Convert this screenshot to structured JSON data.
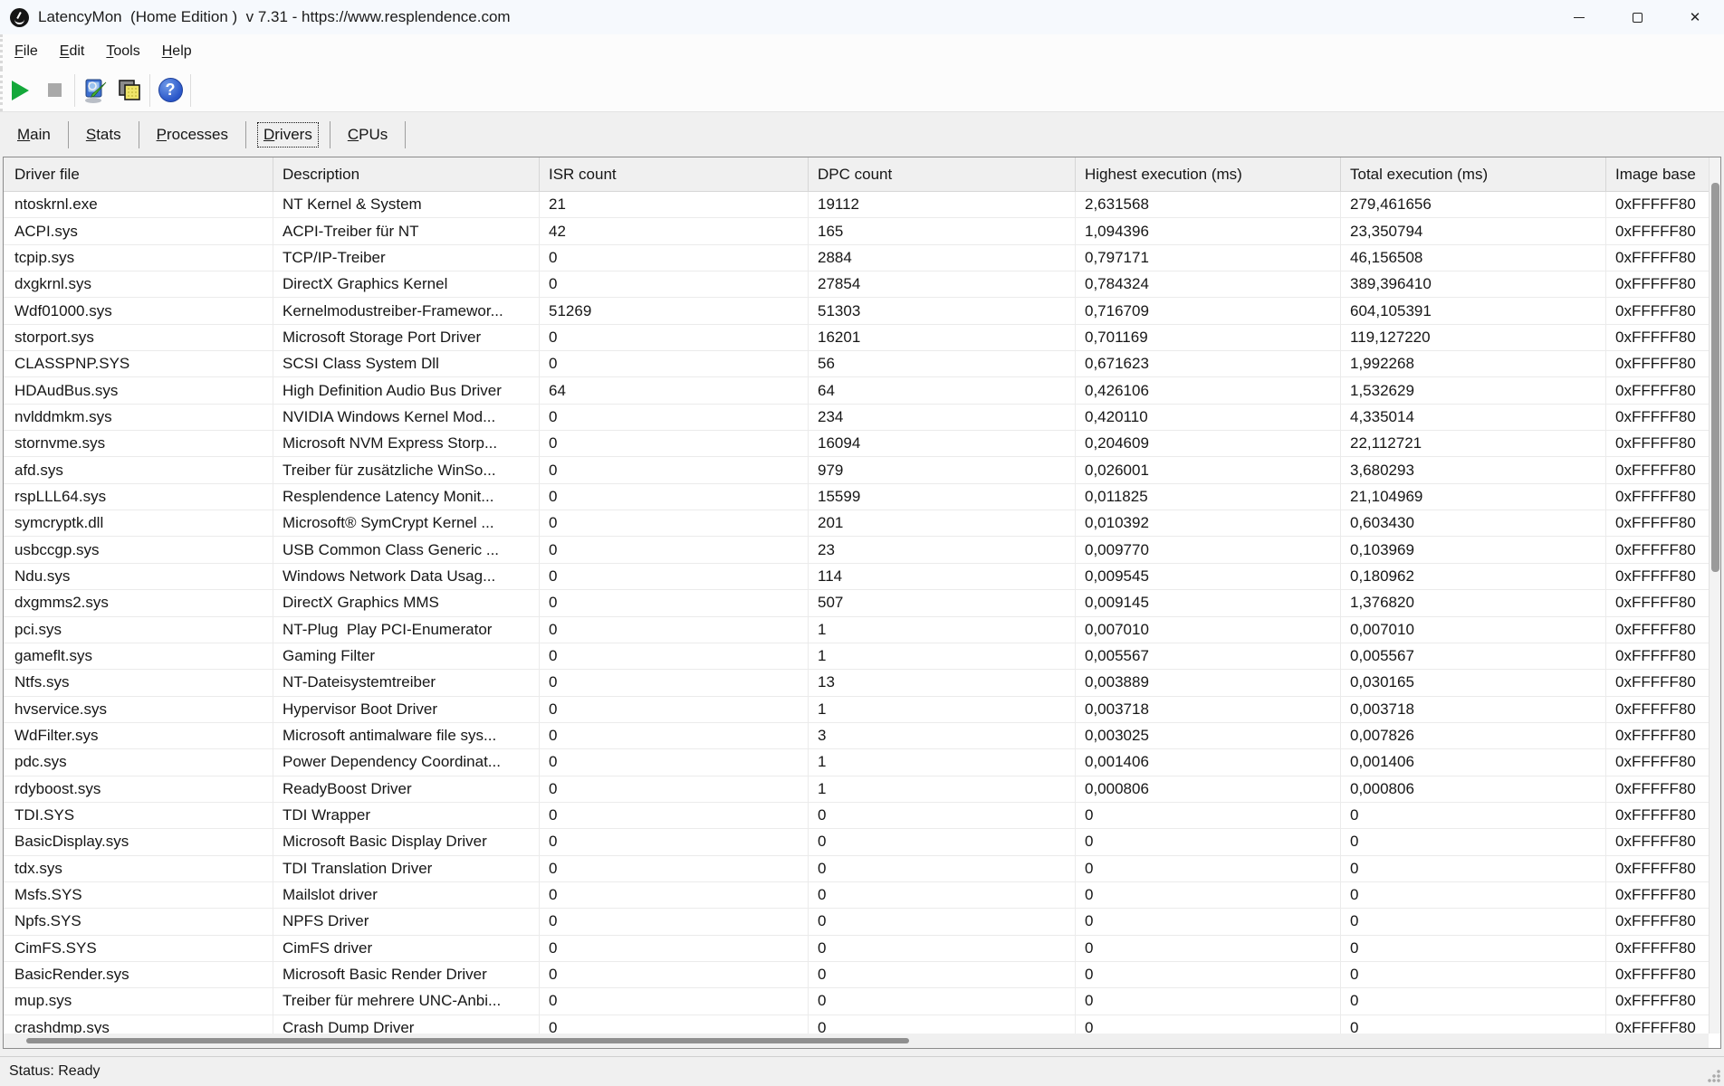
{
  "window": {
    "title": "LatencyMon  (Home Edition )  v 7.31 - https://www.resplendence.com",
    "app_icon": "latencymon-gauge-icon",
    "controls": {
      "minimize": "minimize",
      "maximize": "maximize",
      "close": "close"
    }
  },
  "menu": {
    "items": [
      "File",
      "Edit",
      "Tools",
      "Help"
    ]
  },
  "toolbar": {
    "icons": [
      "start-monitor-icon",
      "stop-monitor-icon",
      "analyze-icon",
      "report-icon",
      "help-icon"
    ]
  },
  "tabs": [
    {
      "label": "Main",
      "active": false
    },
    {
      "label": "Stats",
      "active": false
    },
    {
      "label": "Processes",
      "active": false
    },
    {
      "label": "Drivers",
      "active": true
    },
    {
      "label": "CPUs",
      "active": false
    }
  ],
  "table": {
    "columns": [
      "Driver file",
      "Description",
      "ISR count",
      "DPC count",
      "Highest execution (ms)",
      "Total execution (ms)",
      "Image base"
    ],
    "rows": [
      [
        "ntoskrnl.exe",
        "NT Kernel & System",
        "21",
        "19112",
        "2,631568",
        "279,461656",
        "0xFFFFF80"
      ],
      [
        "ACPI.sys",
        "ACPI-Treiber für NT",
        "42",
        "165",
        "1,094396",
        "23,350794",
        "0xFFFFF80"
      ],
      [
        "tcpip.sys",
        "TCP/IP-Treiber",
        "0",
        "2884",
        "0,797171",
        "46,156508",
        "0xFFFFF80"
      ],
      [
        "dxgkrnl.sys",
        "DirectX Graphics Kernel",
        "0",
        "27854",
        "0,784324",
        "389,396410",
        "0xFFFFF80"
      ],
      [
        "Wdf01000.sys",
        "Kernelmodustreiber-Framewor...",
        "51269",
        "51303",
        "0,716709",
        "604,105391",
        "0xFFFFF80"
      ],
      [
        "storport.sys",
        "Microsoft Storage Port Driver",
        "0",
        "16201",
        "0,701169",
        "119,127220",
        "0xFFFFF80"
      ],
      [
        "CLASSPNP.SYS",
        "SCSI Class System Dll",
        "0",
        "56",
        "0,671623",
        "1,992268",
        "0xFFFFF80"
      ],
      [
        "HDAudBus.sys",
        "High Definition Audio Bus Driver",
        "64",
        "64",
        "0,426106",
        "1,532629",
        "0xFFFFF80"
      ],
      [
        "nvlddmkm.sys",
        "NVIDIA Windows Kernel Mod...",
        "0",
        "234",
        "0,420110",
        "4,335014",
        "0xFFFFF80"
      ],
      [
        "stornvme.sys",
        "Microsoft NVM Express Storp...",
        "0",
        "16094",
        "0,204609",
        "22,112721",
        "0xFFFFF80"
      ],
      [
        "afd.sys",
        "Treiber für zusätzliche WinSo...",
        "0",
        "979",
        "0,026001",
        "3,680293",
        "0xFFFFF80"
      ],
      [
        "rspLLL64.sys",
        "Resplendence Latency Monit...",
        "0",
        "15599",
        "0,011825",
        "21,104969",
        "0xFFFFF80"
      ],
      [
        "symcryptk.dll",
        "Microsoft® SymCrypt Kernel ...",
        "0",
        "201",
        "0,010392",
        "0,603430",
        "0xFFFFF80"
      ],
      [
        "usbccgp.sys",
        "USB Common Class Generic ...",
        "0",
        "23",
        "0,009770",
        "0,103969",
        "0xFFFFF80"
      ],
      [
        "Ndu.sys",
        "Windows Network Data Usag...",
        "0",
        "114",
        "0,009545",
        "0,180962",
        "0xFFFFF80"
      ],
      [
        "dxgmms2.sys",
        "DirectX Graphics MMS",
        "0",
        "507",
        "0,009145",
        "1,376820",
        "0xFFFFF80"
      ],
      [
        "pci.sys",
        "NT-Plug  Play PCI-Enumerator",
        "0",
        "1",
        "0,007010",
        "0,007010",
        "0xFFFFF80"
      ],
      [
        "gameflt.sys",
        "Gaming Filter",
        "0",
        "1",
        "0,005567",
        "0,005567",
        "0xFFFFF80"
      ],
      [
        "Ntfs.sys",
        "NT-Dateisystemtreiber",
        "0",
        "13",
        "0,003889",
        "0,030165",
        "0xFFFFF80"
      ],
      [
        "hvservice.sys",
        "Hypervisor Boot Driver",
        "0",
        "1",
        "0,003718",
        "0,003718",
        "0xFFFFF80"
      ],
      [
        "WdFilter.sys",
        "Microsoft antimalware file sys...",
        "0",
        "3",
        "0,003025",
        "0,007826",
        "0xFFFFF80"
      ],
      [
        "pdc.sys",
        "Power Dependency Coordinat...",
        "0",
        "1",
        "0,001406",
        "0,001406",
        "0xFFFFF80"
      ],
      [
        "rdyboost.sys",
        "ReadyBoost Driver",
        "0",
        "1",
        "0,000806",
        "0,000806",
        "0xFFFFF80"
      ],
      [
        "TDI.SYS",
        "TDI Wrapper",
        "0",
        "0",
        "0",
        "0",
        "0xFFFFF80"
      ],
      [
        "BasicDisplay.sys",
        "Microsoft Basic Display Driver",
        "0",
        "0",
        "0",
        "0",
        "0xFFFFF80"
      ],
      [
        "tdx.sys",
        "TDI Translation Driver",
        "0",
        "0",
        "0",
        "0",
        "0xFFFFF80"
      ],
      [
        "Msfs.SYS",
        "Mailslot driver",
        "0",
        "0",
        "0",
        "0",
        "0xFFFFF80"
      ],
      [
        "Npfs.SYS",
        "NPFS Driver",
        "0",
        "0",
        "0",
        "0",
        "0xFFFFF80"
      ],
      [
        "CimFS.SYS",
        "CimFS driver",
        "0",
        "0",
        "0",
        "0",
        "0xFFFFF80"
      ],
      [
        "BasicRender.sys",
        "Microsoft Basic Render Driver",
        "0",
        "0",
        "0",
        "0",
        "0xFFFFF80"
      ],
      [
        "mup.sys",
        "Treiber für mehrere UNC-Anbi...",
        "0",
        "0",
        "0",
        "0",
        "0xFFFFF80"
      ],
      [
        "crashdmp.sys",
        "Crash Dump Driver",
        "0",
        "0",
        "0",
        "0",
        "0xFFFFF80"
      ]
    ]
  },
  "status_bar": {
    "text": "Status: Ready"
  }
}
